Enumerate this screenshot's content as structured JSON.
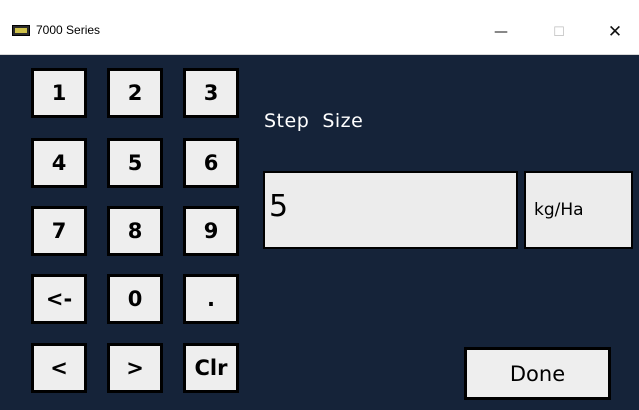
{
  "window": {
    "title": "7000 Series",
    "controls": {
      "minimize": "—",
      "maximize": "☐",
      "close": "✕"
    }
  },
  "icons": {
    "app": "app-icon",
    "minimize": "minimize-icon",
    "maximize": "maximize-icon",
    "close": "close-icon"
  },
  "keypad": {
    "k1": "1",
    "k2": "2",
    "k3": "3",
    "k4": "4",
    "k5": "5",
    "k6": "6",
    "k7": "7",
    "k8": "8",
    "k9": "9",
    "backspace": "<-",
    "k0": "0",
    "dot": ".",
    "left": "<",
    "right": ">",
    "clear": "Clr"
  },
  "field": {
    "label": "Step  Size",
    "value": "5",
    "unit": "kg/Ha"
  },
  "done_label": "Done",
  "colors": {
    "background": "#152339",
    "key": "#eeeeee",
    "border": "#000000",
    "label": "#ffffff"
  }
}
